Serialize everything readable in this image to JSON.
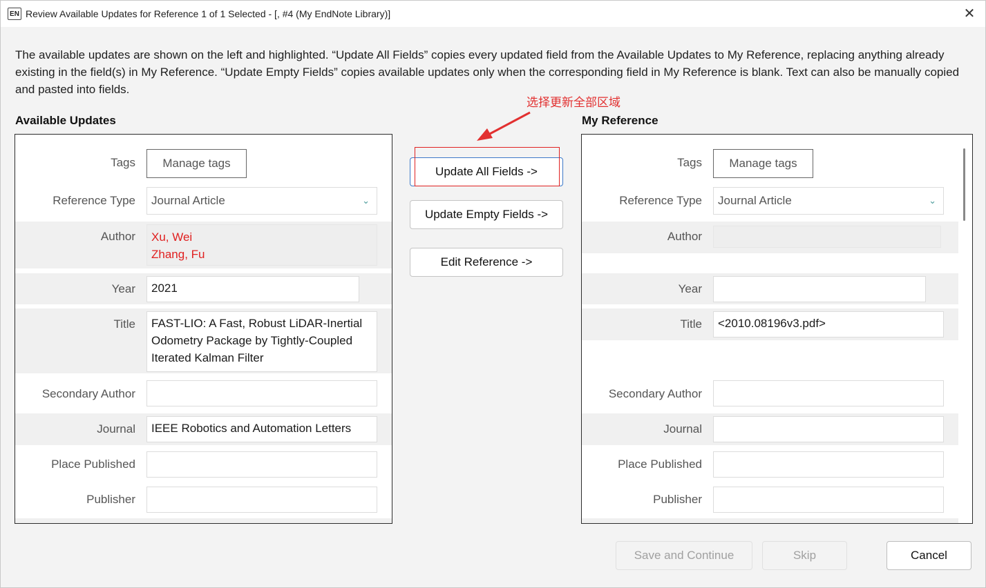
{
  "window": {
    "app_icon": "EN",
    "title": "Review Available Updates for Reference 1 of 1 Selected - [,  #4 (My EndNote Library)]",
    "close_glyph": "✕"
  },
  "description": "The available updates are shown on the left and highlighted. “Update All Fields” copies every updated field from the Available Updates to My Reference, replacing anything already existing in the field(s) in My Reference. “Update Empty Fields” copies available updates only when the corresponding field in My Reference is blank. Text can also be manually copied and pasted into fields.",
  "annotation": {
    "text": "选择更新全部区域",
    "color": "#e23030"
  },
  "available": {
    "heading": "Available Updates",
    "tags_label": "Tags",
    "manage_tags": "Manage tags",
    "ref_type_label": "Reference Type",
    "ref_type_value": "Journal Article",
    "author_label": "Author",
    "author_line1": "Xu, Wei",
    "author_line2": "Zhang, Fu",
    "year_label": "Year",
    "year_value": "2021",
    "title_label": "Title",
    "title_value": "FAST-LIO: A Fast, Robust LiDAR-Inertial Odometry Package by Tightly-Coupled Iterated Kalman Filter",
    "secondary_author_label": "Secondary Author",
    "secondary_author_value": "",
    "journal_label": "Journal",
    "journal_value": "IEEE Robotics and Automation Letters",
    "place_label": "Place Published",
    "place_value": "",
    "publisher_label": "Publisher",
    "publisher_value": ""
  },
  "buttons": {
    "update_all": "Update All Fields ->",
    "update_empty": "Update Empty Fields ->",
    "edit_reference": "Edit Reference ->",
    "save_continue": "Save and Continue",
    "skip": "Skip",
    "cancel": "Cancel"
  },
  "mine": {
    "heading": "My Reference",
    "tags_label": "Tags",
    "manage_tags": "Manage tags",
    "ref_type_label": "Reference Type",
    "ref_type_value": "Journal Article",
    "author_label": "Author",
    "author_value": "",
    "year_label": "Year",
    "year_value": "",
    "title_label": "Title",
    "title_value": "<2010.08196v3.pdf>",
    "secondary_author_label": "Secondary Author",
    "secondary_author_value": "",
    "journal_label": "Journal",
    "journal_value": "",
    "place_label": "Place Published",
    "place_value": "",
    "publisher_label": "Publisher",
    "publisher_value": ""
  },
  "icons": {
    "chevron": "chevron-down-icon",
    "close": "close-icon"
  }
}
